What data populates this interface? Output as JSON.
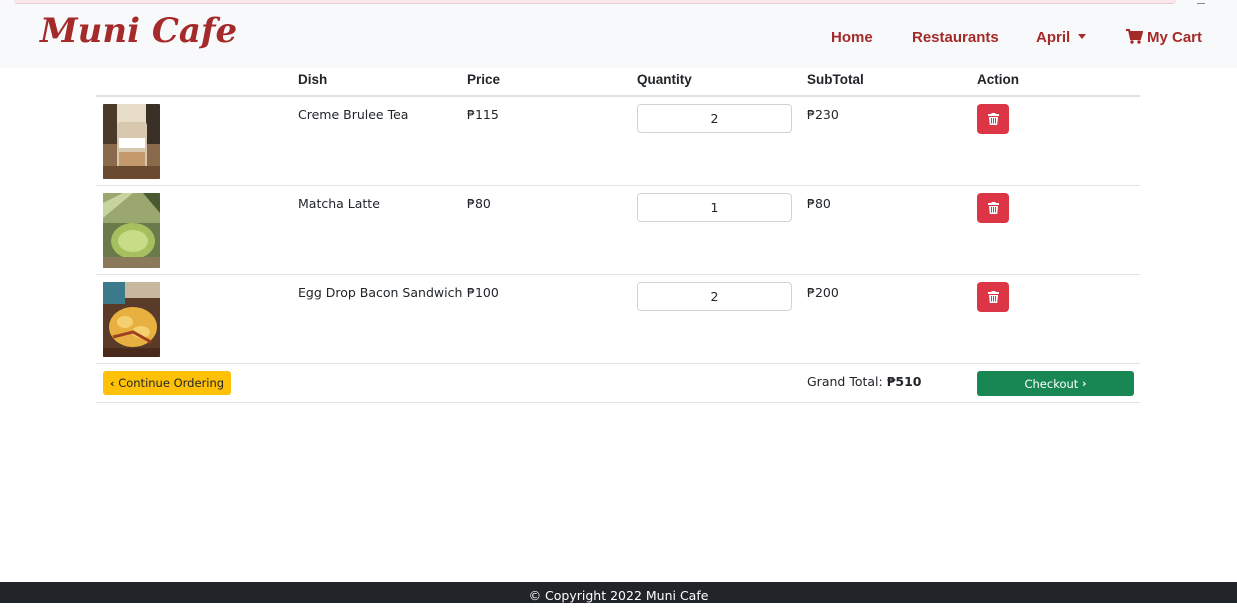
{
  "brand": {
    "name": "Muni Cafe"
  },
  "nav": {
    "home": "Home",
    "restaurants": "Restaurants",
    "user": "April",
    "cart": "My Cart"
  },
  "cart_table": {
    "headers": {
      "dish": "Dish",
      "price": "Price",
      "quantity": "Quantity",
      "subtotal": "SubTotal",
      "action": "Action"
    },
    "rows": [
      {
        "dish": "Creme Brulee Tea",
        "price": "₱115",
        "quantity": "2",
        "subtotal": "₱230",
        "image": "creme-brulee-tea-photo"
      },
      {
        "dish": "Matcha Latte",
        "price": "₱80",
        "quantity": "1",
        "subtotal": "₱80",
        "image": "matcha-latte-photo"
      },
      {
        "dish": "Egg Drop Bacon Sandwich",
        "price": "₱100",
        "quantity": "2",
        "subtotal": "₱200",
        "image": "egg-drop-bacon-sandwich-photo"
      }
    ],
    "continue_label": "Continue Ordering",
    "grand_total_label": "Grand Total:",
    "grand_total_value": "₱510",
    "checkout_label": "Checkout"
  },
  "footer": {
    "text": "© Copyright 2022 Muni Cafe"
  },
  "colors": {
    "brand": "#a52a2a",
    "navbar_bg": "#f8f9fa",
    "danger": "#dc3545",
    "warning": "#ffc107",
    "success": "#198754",
    "footer_bg": "#212529"
  }
}
